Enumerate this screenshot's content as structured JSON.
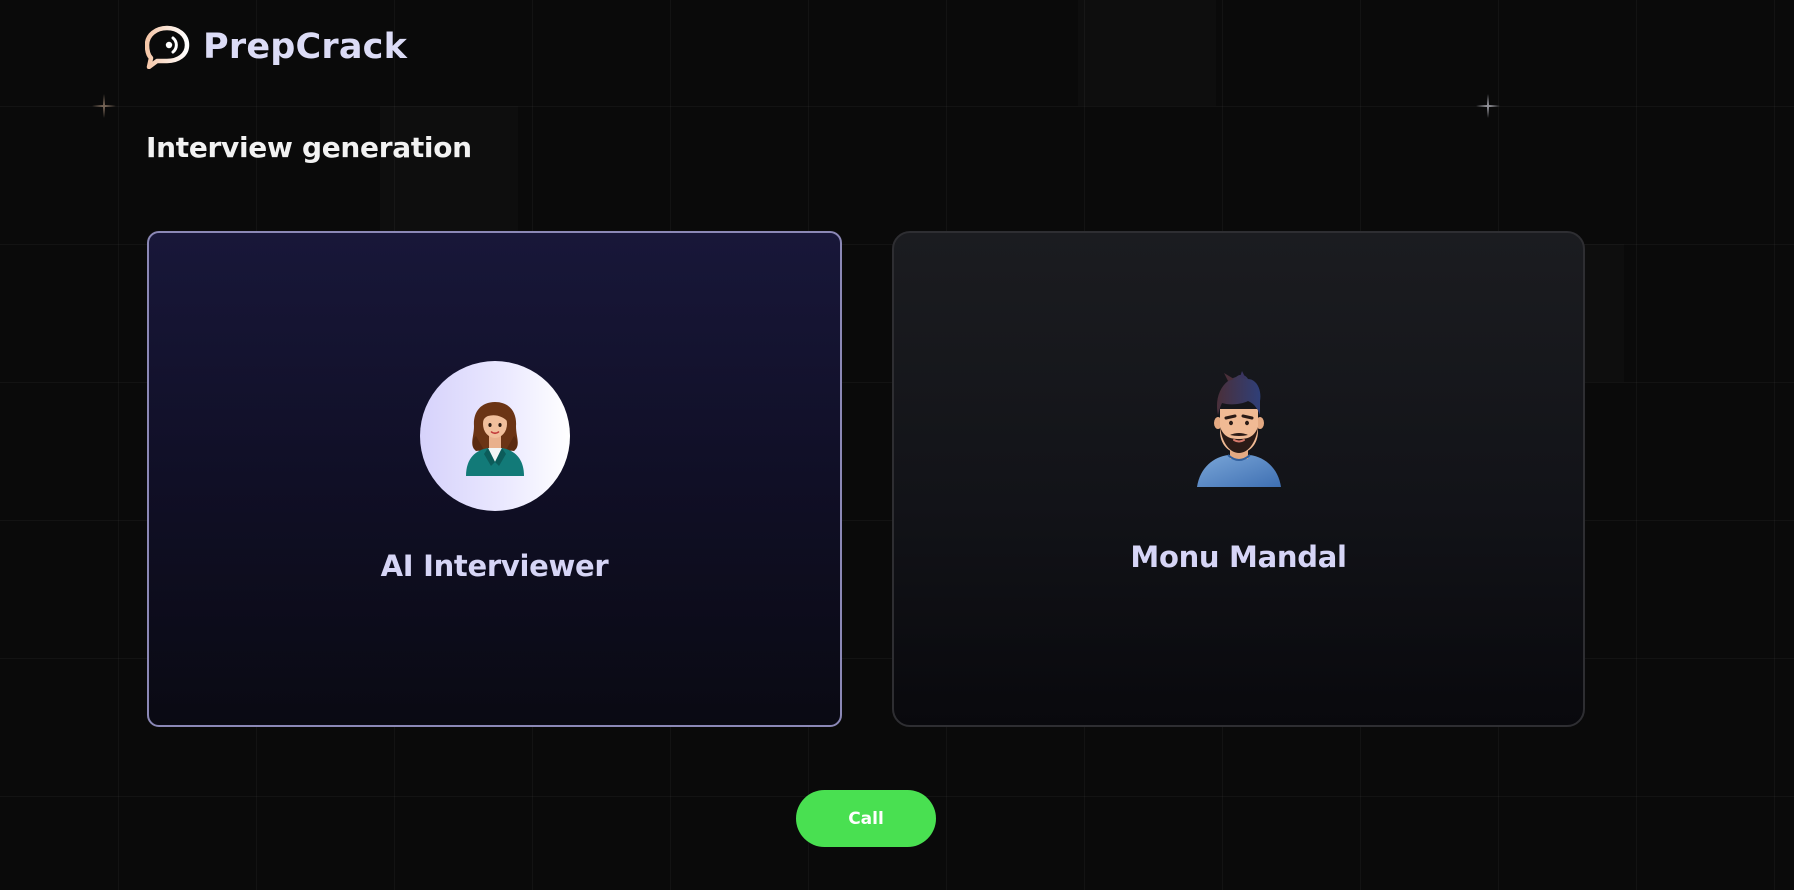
{
  "brand": {
    "name": "PrepCrack",
    "logo_icon": "chat-bubble-broadcast-icon"
  },
  "page": {
    "title": "Interview generation"
  },
  "participants": [
    {
      "name": "AI Interviewer",
      "avatar_icon": "female-interviewer-avatar-icon"
    },
    {
      "name": "Monu Mandal",
      "avatar_icon": "male-user-avatar-icon"
    }
  ],
  "actions": {
    "call_label": "Call"
  },
  "colors": {
    "background": "#0a0a0a",
    "accent_green": "#49e051",
    "ai_card_border": "#8b88b6",
    "ai_card_top": "#181739",
    "user_card_border": "#2e2e32",
    "name_text": "#d6d5f6",
    "brand_gradient_start": "#f6c7a8",
    "brand_gradient_end": "#ffffff"
  }
}
